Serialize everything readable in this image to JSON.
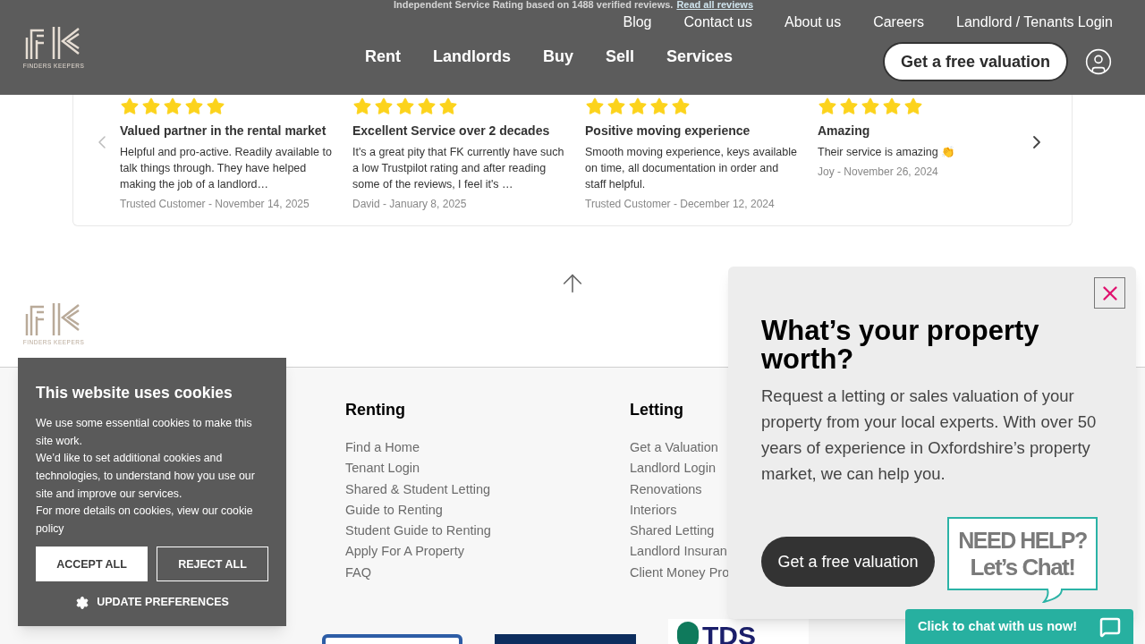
{
  "rating_line": {
    "text": "Independent Service Rating based on 1488 verified reviews.",
    "link": "Read all reviews"
  },
  "header": {
    "logo_text": "FINDERS KEEPERS",
    "top_links": [
      "Blog",
      "Contact us",
      "About us",
      "Careers",
      "Landlord / Tenants Login"
    ],
    "main_links": [
      "Rent",
      "Landlords",
      "Buy",
      "Sell",
      "Services"
    ],
    "cta": "Get a free valuation"
  },
  "reviews": [
    {
      "stars": 5,
      "title": "Valued partner in the rental market",
      "body": "Helpful and pro-active. Readily available to talk things through. They have helped making the job of a landlord…",
      "byline": "Trusted Customer - November 14, 2025"
    },
    {
      "stars": 5,
      "title": "Excellent Service over 2 decades",
      "body": "It's a great pity that FK currently have such a low Trustpilot rating and after reading some of the reviews, I feel it's …",
      "byline": "David - January 8, 2025"
    },
    {
      "stars": 5,
      "title": "Positive moving experience",
      "body": "Smooth moving experience, keys available on time, all documentation in order and staff helpful.",
      "byline": "Trusted Customer - December 12, 2024"
    },
    {
      "stars": 5,
      "title": "Amazing",
      "body": "Their service is amazing 👏",
      "byline": "Joy - November 26, 2024"
    }
  ],
  "footer": {
    "logo_text": "FINDERS KEEPERS",
    "columns": [
      {
        "heading": "Renting",
        "links": [
          "Find a Home",
          "Tenant Login",
          "Shared & Student Letting",
          "Guide to Renting",
          "Student Guide to Renting",
          "Apply For A Property",
          "FAQ"
        ]
      },
      {
        "heading": "Letting",
        "links": [
          "Get a Valuation",
          "Landlord Login",
          "Renovations",
          "Interiors",
          "Shared Letting",
          "Landlord Insuran",
          "Client Money Pro"
        ]
      }
    ],
    "partner_logos": [
      {
        "kind": "outlined"
      },
      {
        "kind": "navy"
      },
      {
        "kind": "tds",
        "text": "TDS"
      }
    ]
  },
  "cookie_banner": {
    "title": "This website uses cookies",
    "paragraphs": [
      "We use some essential cookies to make this site work.",
      "We’d like to set additional cookies and technologies, to understand how you use our site and improve our services.",
      "For more details on cookies, view our cookie policy"
    ],
    "accept": "ACCEPT ALL",
    "reject": "REJECT ALL",
    "preferences": "UPDATE PREFERENCES"
  },
  "valuation_popup": {
    "title": "What’s your property worth?",
    "body": "Request a letting or sales valuation of your property from your local experts. With over 50 years of experience in Oxfordshire’s property market, we can help you.",
    "cta": "Get a free valuation"
  },
  "chat": {
    "bubble_line_1": "NEED HELP?",
    "bubble_line_2": "Let’s Chat!",
    "bar": "Click to chat with us now!"
  }
}
